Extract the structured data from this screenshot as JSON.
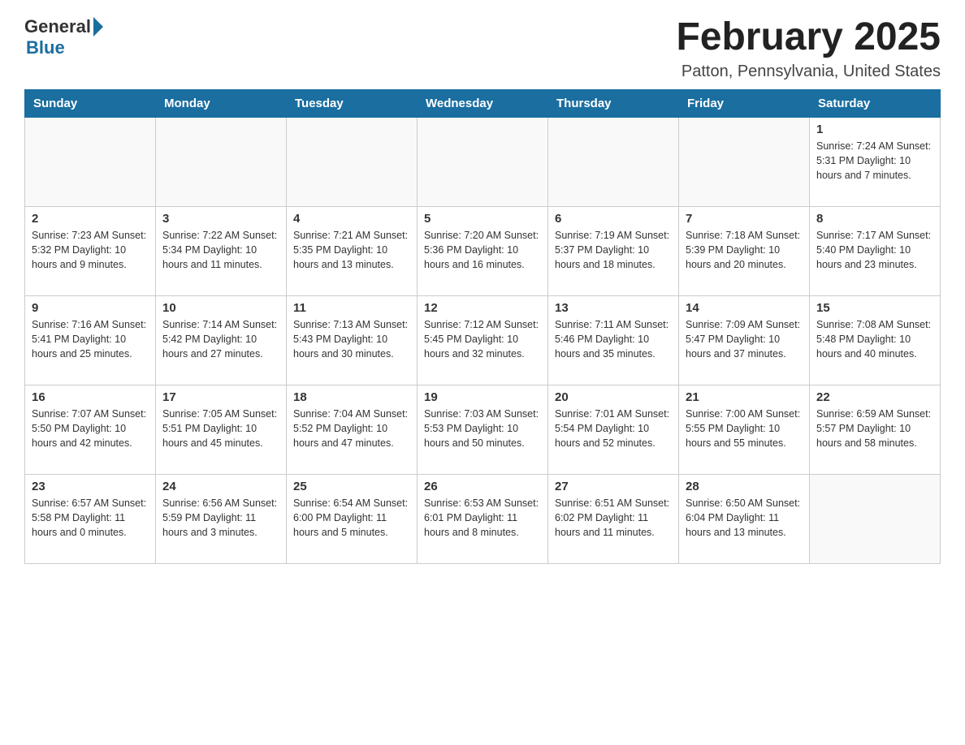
{
  "header": {
    "logo_general": "General",
    "logo_blue": "Blue",
    "month_title": "February 2025",
    "location": "Patton, Pennsylvania, United States"
  },
  "days_of_week": [
    "Sunday",
    "Monday",
    "Tuesday",
    "Wednesday",
    "Thursday",
    "Friday",
    "Saturday"
  ],
  "weeks": [
    [
      {
        "day": "",
        "info": ""
      },
      {
        "day": "",
        "info": ""
      },
      {
        "day": "",
        "info": ""
      },
      {
        "day": "",
        "info": ""
      },
      {
        "day": "",
        "info": ""
      },
      {
        "day": "",
        "info": ""
      },
      {
        "day": "1",
        "info": "Sunrise: 7:24 AM\nSunset: 5:31 PM\nDaylight: 10 hours and 7 minutes."
      }
    ],
    [
      {
        "day": "2",
        "info": "Sunrise: 7:23 AM\nSunset: 5:32 PM\nDaylight: 10 hours and 9 minutes."
      },
      {
        "day": "3",
        "info": "Sunrise: 7:22 AM\nSunset: 5:34 PM\nDaylight: 10 hours and 11 minutes."
      },
      {
        "day": "4",
        "info": "Sunrise: 7:21 AM\nSunset: 5:35 PM\nDaylight: 10 hours and 13 minutes."
      },
      {
        "day": "5",
        "info": "Sunrise: 7:20 AM\nSunset: 5:36 PM\nDaylight: 10 hours and 16 minutes."
      },
      {
        "day": "6",
        "info": "Sunrise: 7:19 AM\nSunset: 5:37 PM\nDaylight: 10 hours and 18 minutes."
      },
      {
        "day": "7",
        "info": "Sunrise: 7:18 AM\nSunset: 5:39 PM\nDaylight: 10 hours and 20 minutes."
      },
      {
        "day": "8",
        "info": "Sunrise: 7:17 AM\nSunset: 5:40 PM\nDaylight: 10 hours and 23 minutes."
      }
    ],
    [
      {
        "day": "9",
        "info": "Sunrise: 7:16 AM\nSunset: 5:41 PM\nDaylight: 10 hours and 25 minutes."
      },
      {
        "day": "10",
        "info": "Sunrise: 7:14 AM\nSunset: 5:42 PM\nDaylight: 10 hours and 27 minutes."
      },
      {
        "day": "11",
        "info": "Sunrise: 7:13 AM\nSunset: 5:43 PM\nDaylight: 10 hours and 30 minutes."
      },
      {
        "day": "12",
        "info": "Sunrise: 7:12 AM\nSunset: 5:45 PM\nDaylight: 10 hours and 32 minutes."
      },
      {
        "day": "13",
        "info": "Sunrise: 7:11 AM\nSunset: 5:46 PM\nDaylight: 10 hours and 35 minutes."
      },
      {
        "day": "14",
        "info": "Sunrise: 7:09 AM\nSunset: 5:47 PM\nDaylight: 10 hours and 37 minutes."
      },
      {
        "day": "15",
        "info": "Sunrise: 7:08 AM\nSunset: 5:48 PM\nDaylight: 10 hours and 40 minutes."
      }
    ],
    [
      {
        "day": "16",
        "info": "Sunrise: 7:07 AM\nSunset: 5:50 PM\nDaylight: 10 hours and 42 minutes."
      },
      {
        "day": "17",
        "info": "Sunrise: 7:05 AM\nSunset: 5:51 PM\nDaylight: 10 hours and 45 minutes."
      },
      {
        "day": "18",
        "info": "Sunrise: 7:04 AM\nSunset: 5:52 PM\nDaylight: 10 hours and 47 minutes."
      },
      {
        "day": "19",
        "info": "Sunrise: 7:03 AM\nSunset: 5:53 PM\nDaylight: 10 hours and 50 minutes."
      },
      {
        "day": "20",
        "info": "Sunrise: 7:01 AM\nSunset: 5:54 PM\nDaylight: 10 hours and 52 minutes."
      },
      {
        "day": "21",
        "info": "Sunrise: 7:00 AM\nSunset: 5:55 PM\nDaylight: 10 hours and 55 minutes."
      },
      {
        "day": "22",
        "info": "Sunrise: 6:59 AM\nSunset: 5:57 PM\nDaylight: 10 hours and 58 minutes."
      }
    ],
    [
      {
        "day": "23",
        "info": "Sunrise: 6:57 AM\nSunset: 5:58 PM\nDaylight: 11 hours and 0 minutes."
      },
      {
        "day": "24",
        "info": "Sunrise: 6:56 AM\nSunset: 5:59 PM\nDaylight: 11 hours and 3 minutes."
      },
      {
        "day": "25",
        "info": "Sunrise: 6:54 AM\nSunset: 6:00 PM\nDaylight: 11 hours and 5 minutes."
      },
      {
        "day": "26",
        "info": "Sunrise: 6:53 AM\nSunset: 6:01 PM\nDaylight: 11 hours and 8 minutes."
      },
      {
        "day": "27",
        "info": "Sunrise: 6:51 AM\nSunset: 6:02 PM\nDaylight: 11 hours and 11 minutes."
      },
      {
        "day": "28",
        "info": "Sunrise: 6:50 AM\nSunset: 6:04 PM\nDaylight: 11 hours and 13 minutes."
      },
      {
        "day": "",
        "info": ""
      }
    ]
  ]
}
